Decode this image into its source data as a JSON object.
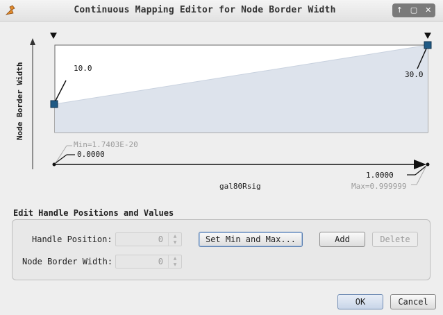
{
  "window": {
    "title": "Continuous Mapping Editor for Node Border Width",
    "controls": [
      "↑",
      "▢",
      "✕"
    ]
  },
  "chart_data": {
    "type": "line",
    "ylabel": "Node Border Width",
    "xlabel": "gal80Rsig",
    "x_range": [
      0.0,
      1.0
    ],
    "points": [
      {
        "x": 0.0,
        "y": 10.0,
        "label": "10.0"
      },
      {
        "x": 1.0,
        "y": 30.0,
        "label": "30.0"
      }
    ],
    "ylim": [
      0.0,
      30.0
    ],
    "min_text": "Min=1.7403E-20",
    "max_text": "Max=0.999999",
    "left_value": "0.0000",
    "right_value": "1.0000",
    "fill_color": "#dde3ec",
    "handle_color": "#1f5a85"
  },
  "edit": {
    "section_title": "Edit Handle Positions and Values",
    "handle_position_label": "Handle Position:",
    "handle_position_value": "0",
    "node_border_width_label": "Node Border Width:",
    "node_border_width_value": "0",
    "set_min_max_label": "Set Min and Max...",
    "add_label": "Add",
    "delete_label": "Delete"
  },
  "footer": {
    "ok_label": "OK",
    "cancel_label": "Cancel"
  }
}
